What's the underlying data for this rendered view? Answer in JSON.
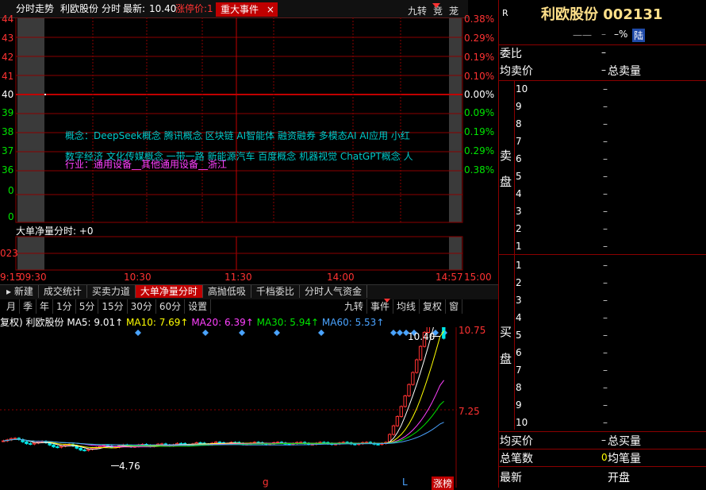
{
  "header": {
    "title": "分时走势",
    "stock_name": "利欧股份",
    "mode": "分时",
    "latest_label": "最新:",
    "latest_value": "10.40",
    "limit_label": "涨停价:1",
    "event_tab": "重大事件",
    "close_symbol": "×",
    "btn_jiuzhuan": "九转",
    "btn_jing": "竞",
    "btn_long": "茏"
  },
  "right_panel": {
    "r_badge": "R",
    "title": "利欧股份 002131",
    "sub1": "一一",
    "sub2": "–",
    "sub3": "–%",
    "lu_badge": "陆",
    "weibi": "委比",
    "weibi_val": "–",
    "junmaijia": "均卖价",
    "junmaijia_val": "–",
    "zongmailiang": "总卖量",
    "sell_side": "卖",
    "sell_side2": "盘",
    "buy_side": "买",
    "buy_side2": "盘",
    "sell_levels": [
      {
        "level": "10",
        "value": "–"
      },
      {
        "level": "9",
        "value": "–"
      },
      {
        "level": "8",
        "value": "–"
      },
      {
        "level": "7",
        "value": "–"
      },
      {
        "level": "6",
        "value": "–"
      },
      {
        "level": "5",
        "value": "–"
      },
      {
        "level": "4",
        "value": "–"
      },
      {
        "level": "3",
        "value": "–"
      },
      {
        "level": "2",
        "value": "–"
      },
      {
        "level": "1",
        "value": "–"
      }
    ],
    "buy_levels": [
      {
        "level": "1",
        "value": "–"
      },
      {
        "level": "2",
        "value": "–"
      },
      {
        "level": "3",
        "value": "–"
      },
      {
        "level": "4",
        "value": "–"
      },
      {
        "level": "5",
        "value": "–"
      },
      {
        "level": "6",
        "value": "–"
      },
      {
        "level": "7",
        "value": "–"
      },
      {
        "level": "8",
        "value": "–"
      },
      {
        "level": "9",
        "value": "–"
      },
      {
        "level": "10",
        "value": "–"
      }
    ],
    "junmaijia2": "均买价",
    "junmaijia2_val": "–",
    "zongmailiang2": "总买量",
    "zongbishu": "总笔数",
    "zongbishu_val": "0",
    "junbiliang": "均笔量",
    "zuixin": "最新",
    "kaipan": "开盘"
  },
  "intraday": {
    "left_axis": [
      "44",
      "43",
      "42",
      "41",
      "40",
      "39",
      "38",
      "37",
      "36",
      "0",
      "0"
    ],
    "right_axis": [
      "0.38%",
      "0.29%",
      "0.19%",
      "0.10%",
      "0.00%",
      "0.09%",
      "0.19%",
      "0.29%",
      "0.38%"
    ],
    "concepts": "概念：DeepSeek概念  腾讯概念  区块链  AI智能体  融资融券  多模态AI  AI应用  小红",
    "concepts2": "数字经济  文化传媒概念  一带一路  新能源汽车  百度概念  机器视觉  ChatGPT概念  人",
    "industry": "行业：通用设备__其他通用设备__浙江",
    "net_label": "大单净量分时: +0",
    "sub_axis": "023",
    "time_labels": [
      "9:15",
      "09:30",
      "10:30",
      "11:30",
      "14:00",
      "14:57",
      "15:00"
    ]
  },
  "tabs": [
    "新建",
    "成交统计",
    "买卖力道",
    "大单净量分时",
    "高抛低吸",
    "千档委比",
    "分时人气资金"
  ],
  "kline_toolbar": {
    "periods": [
      "月",
      "季",
      "年",
      "1分",
      "5分",
      "15分",
      "30分",
      "60分",
      "设置"
    ],
    "right_btns": [
      "九转",
      "事件",
      "均线",
      "复权",
      "窗"
    ]
  },
  "kline": {
    "prefix": "复权)",
    "name": "利欧股份",
    "ma5_label": "MA5: 9.01↑",
    "ma10_label": "MA10: 7.69↑",
    "ma20_label": "MA20: 6.39↑",
    "ma30_label": "MA30: 5.94↑",
    "ma60_label": "MA60: 5.53↑",
    "price_high": "10.75",
    "price_mid": "7.25",
    "high_marker": "10.40",
    "low_marker": "4.76",
    "bottom_tags": [
      "g",
      "L",
      "涨榜"
    ]
  },
  "colors": {
    "up": "#ff3232",
    "down": "#00e600",
    "ma5": "#ffffff",
    "ma10": "#ffff00",
    "ma20": "#ff40ff",
    "ma30": "#00e600",
    "ma60": "#4aa3ff"
  }
}
